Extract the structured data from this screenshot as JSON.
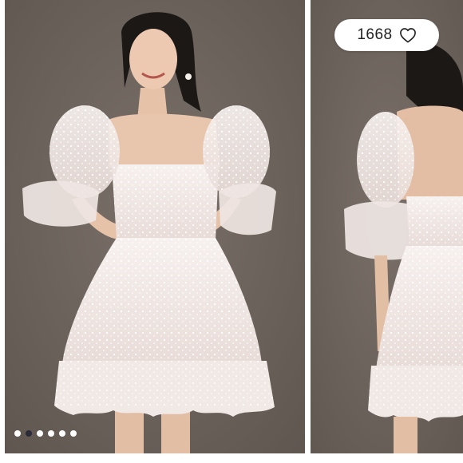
{
  "listing": {
    "like_count": "1668",
    "like_icon": "heart-outline-icon",
    "photos": [
      {
        "view": "front",
        "alt": ""
      },
      {
        "view": "back",
        "alt": ""
      }
    ]
  },
  "carousel": {
    "total": 6,
    "active_index": 1
  },
  "colors": {
    "backdrop": "#6e645d",
    "dress": "#f3ecea",
    "pill_bg": "#ffffff",
    "dot_active": "#2b2b3a",
    "dot_inactive": "#ffffff"
  }
}
